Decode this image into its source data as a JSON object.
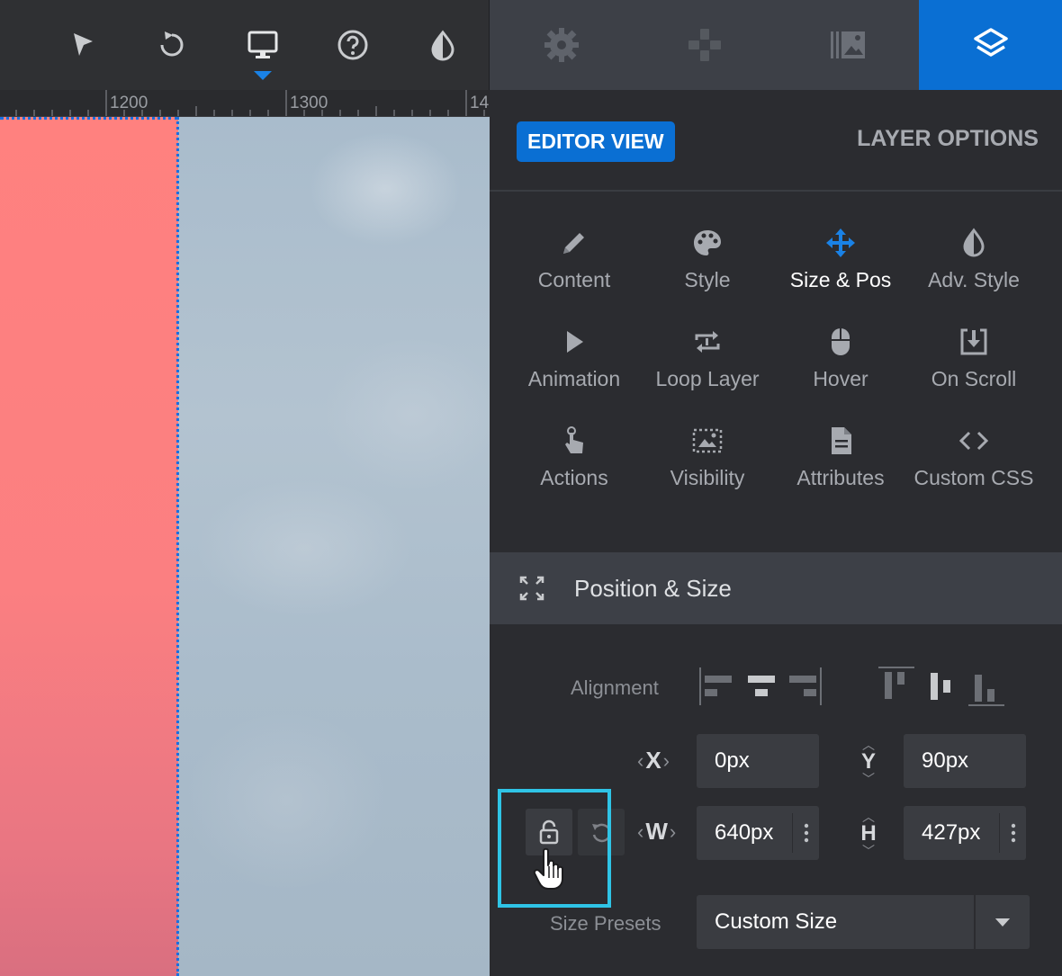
{
  "toolbar": {
    "tools": [
      {
        "icon": "pointer-icon"
      },
      {
        "icon": "undo-icon"
      },
      {
        "icon": "desktop-icon",
        "active": true
      },
      {
        "icon": "help-icon"
      },
      {
        "icon": "contrast-drop-icon"
      }
    ]
  },
  "panel_tabs": [
    {
      "icon": "gear-icon"
    },
    {
      "icon": "gamepad-icon"
    },
    {
      "icon": "media-library-icon"
    },
    {
      "icon": "layers-icon",
      "active": true
    }
  ],
  "ruler": {
    "labels": [
      "1200",
      "1300",
      "14"
    ]
  },
  "view_tabs": {
    "editor_view": "EDITOR VIEW",
    "layer_options": "LAYER OPTIONS"
  },
  "option_grid": [
    {
      "label": "Content",
      "icon": "pencil-icon"
    },
    {
      "label": "Style",
      "icon": "palette-icon"
    },
    {
      "label": "Size & Pos",
      "icon": "move-arrows-icon",
      "active": true
    },
    {
      "label": "Adv. Style",
      "icon": "contrast-drop-icon"
    },
    {
      "label": "Animation",
      "icon": "play-icon"
    },
    {
      "label": "Loop Layer",
      "icon": "loop-icon"
    },
    {
      "label": "Hover",
      "icon": "mouse-icon"
    },
    {
      "label": "On Scroll",
      "icon": "scroll-download-icon"
    },
    {
      "label": "Actions",
      "icon": "tap-hand-icon"
    },
    {
      "label": "Visibility",
      "icon": "visibility-image-icon"
    },
    {
      "label": "Attributes",
      "icon": "document-icon"
    },
    {
      "label": "Custom CSS",
      "icon": "code-icon"
    }
  ],
  "section": {
    "title": "Position & Size",
    "icon": "expand-icon"
  },
  "position": {
    "alignment_label": "Alignment",
    "x_label": "X",
    "y_label": "Y",
    "w_label": "W",
    "h_label": "H",
    "x_value": "0px",
    "y_value": "90px",
    "w_value": "640px",
    "h_value": "427px",
    "size_presets_label": "Size Presets",
    "size_preset_value": "Custom Size"
  },
  "colors": {
    "accent": "#0a6fd3",
    "highlight": "#2fc4e6",
    "canvas_pink": "#ff817f"
  }
}
